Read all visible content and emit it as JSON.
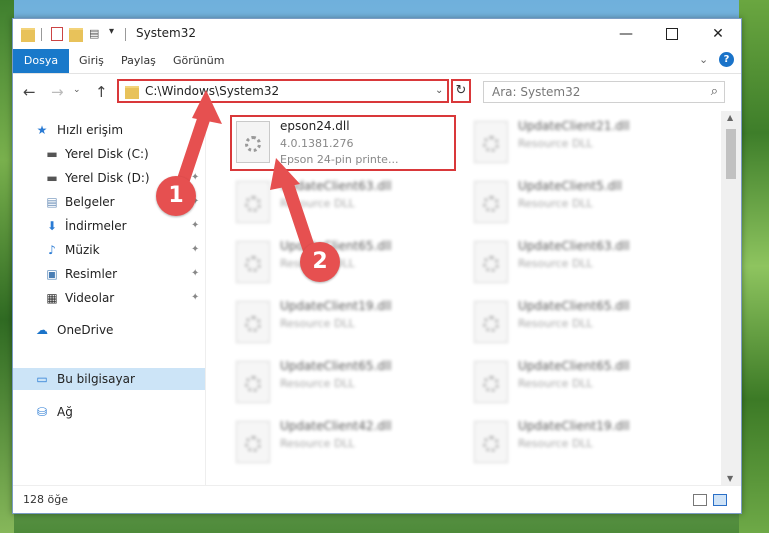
{
  "window": {
    "title": "System32",
    "minimize_glyph": "—",
    "close_glyph": "✕"
  },
  "ribbon": {
    "tabs": [
      "Dosya",
      "Giriş",
      "Paylaş",
      "Görünüm"
    ],
    "help": "?"
  },
  "nav": {
    "address": "C:\\Windows\\System32",
    "search_placeholder": "Ara: System32"
  },
  "sidebar": {
    "quick_access": "Hızlı erişim",
    "items": [
      {
        "label": "Yerel Disk (C:)",
        "icon": "drive-icon",
        "pinned": true
      },
      {
        "label": "Yerel Disk (D:)",
        "icon": "drive-icon",
        "pinned": true
      },
      {
        "label": "Belgeler",
        "icon": "documents-icon",
        "pinned": true
      },
      {
        "label": "İndirmeler",
        "icon": "download-icon",
        "pinned": true
      },
      {
        "label": "Müzik",
        "icon": "music-icon",
        "pinned": true
      },
      {
        "label": "Resimler",
        "icon": "pictures-icon",
        "pinned": true
      },
      {
        "label": "Videolar",
        "icon": "videos-icon",
        "pinned": true
      }
    ],
    "onedrive": "OneDrive",
    "this_pc": "Bu bilgisayar",
    "network": "Ağ"
  },
  "files": [
    {
      "name": "epson24.dll",
      "version": "4.0.1381.276",
      "description": "Epson 24-pin printe..."
    },
    {
      "name": "UpdateClient21.dll",
      "type": "Resource DLL"
    },
    {
      "name": "UpdateClient63.dll",
      "type": "Resource DLL"
    },
    {
      "name": "UpdateClient5.dll",
      "type": "Resource DLL"
    },
    {
      "name": "UpdateClient65.dll",
      "type": "Resource DLL"
    },
    {
      "name": "UpdateClient63.dll",
      "type": "Resource DLL"
    },
    {
      "name": "UpdateClient19.dll",
      "type": "Resource DLL"
    },
    {
      "name": "UpdateClient65.dll",
      "type": "Resource DLL"
    },
    {
      "name": "UpdateClient65.dll",
      "type": "Resource DLL"
    },
    {
      "name": "UpdateClient65.dll",
      "type": "Resource DLL"
    },
    {
      "name": "UpdateClient42.dll",
      "type": "Resource DLL"
    },
    {
      "name": "UpdateClient19.dll",
      "type": "Resource DLL"
    }
  ],
  "status": {
    "item_count": "128 öğe"
  },
  "annotations": {
    "step1": "1",
    "step2": "2",
    "color": "#e65050"
  }
}
